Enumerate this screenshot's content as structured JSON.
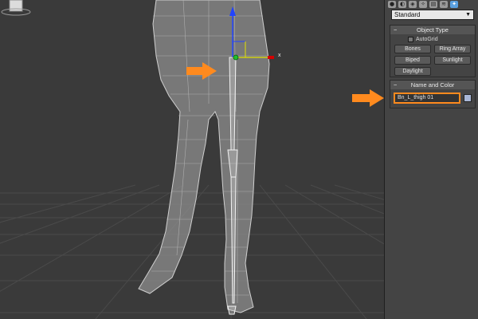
{
  "panel": {
    "tabs": [
      "●",
      "◐",
      "◈",
      "✧",
      "▤",
      "≋",
      "✦"
    ],
    "dropdown_value": "Standard",
    "object_type": {
      "title": "Object Type",
      "autogrid_label": "AutoGrid",
      "buttons": [
        "Bones",
        "Ring Array",
        "Biped",
        "Sunlight",
        "Daylight"
      ]
    },
    "name_and_color": {
      "title": "Name and Color",
      "name_value": "Bn_L_thigh 01"
    }
  },
  "viewport": {
    "gizmo_x_label": "x"
  },
  "colors": {
    "highlight": "#ff8a1e",
    "viewport_bg": "#3a3a3a",
    "panel_bg": "#444444"
  }
}
